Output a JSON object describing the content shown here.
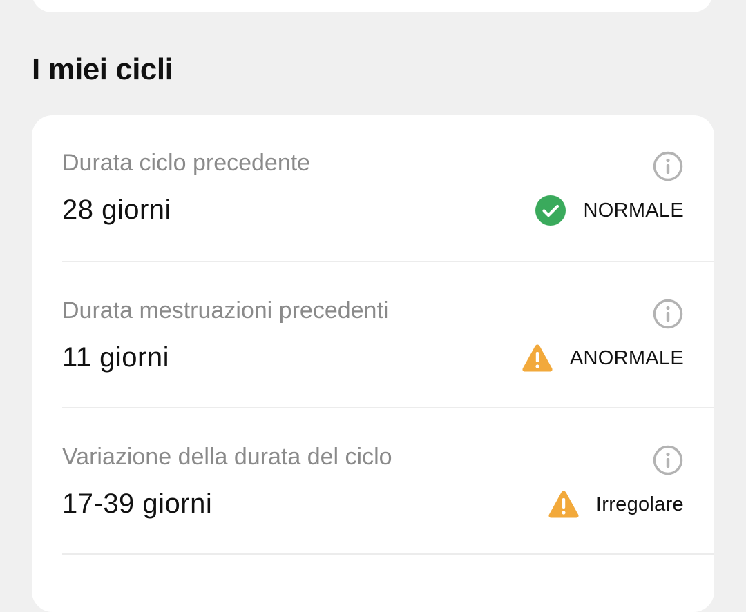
{
  "section": {
    "title": "I miei cicli"
  },
  "rows": [
    {
      "label": "Durata ciclo precedente",
      "value": "28 giorni",
      "status": "NORMALE",
      "status_icon": "check-circle-icon",
      "status_color": "#3aaa5c"
    },
    {
      "label": "Durata mestruazioni precedenti",
      "value": "11 giorni",
      "status": "ANORMALE",
      "status_icon": "warning-triangle-icon",
      "status_color": "#f2a93b"
    },
    {
      "label": "Variazione della durata del ciclo",
      "value": "17-39 giorni",
      "status": "Irregolare",
      "status_icon": "warning-triangle-icon",
      "status_color": "#f2a93b"
    }
  ],
  "colors": {
    "background": "#f0f0f0",
    "card": "#ffffff",
    "label": "#8a8a8a",
    "info_icon": "#b3b3b3"
  }
}
